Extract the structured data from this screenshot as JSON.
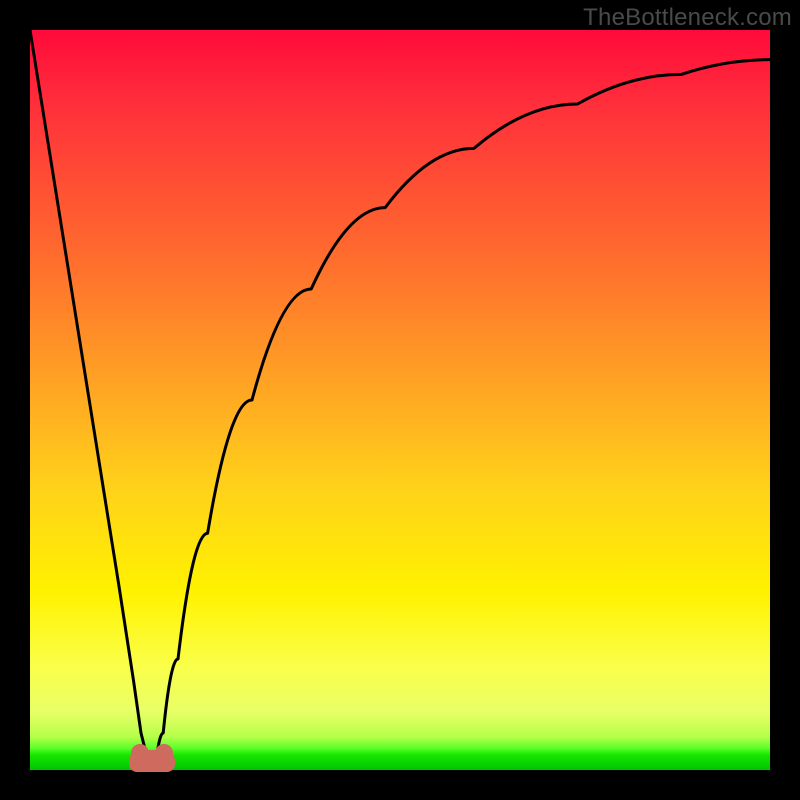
{
  "watermark": "TheBottleneck.com",
  "colors": {
    "frame": "#000000",
    "gradient_top": "#ff0a3a",
    "gradient_mid1": "#ff6a2e",
    "gradient_mid2": "#ffd21a",
    "gradient_mid3": "#fff200",
    "gradient_bottom": "#00c400",
    "curve_stroke": "#000000",
    "bump": "#cf6a5f"
  },
  "chart_data": {
    "type": "line",
    "title": "",
    "xlabel": "",
    "ylabel": "",
    "xlim": [
      0,
      100
    ],
    "ylim": [
      0,
      100
    ],
    "grid": false,
    "legend": false,
    "curve_note": "V-shaped bottleneck curve: steep linear descent from top-left to a minimum near x≈16, then a decelerating rise (roughly logarithmic) toward the top-right. Y is plotted with 0 at the bottom (green) and 100 at the top (red).",
    "x": [
      0,
      4,
      8,
      12,
      14,
      15,
      16,
      17,
      18,
      20,
      24,
      30,
      38,
      48,
      60,
      74,
      88,
      100
    ],
    "y": [
      100,
      75,
      50,
      25,
      12,
      5,
      1,
      1,
      5,
      15,
      32,
      50,
      65,
      76,
      84,
      90,
      94,
      96
    ],
    "minimum": {
      "x": 16.5,
      "y": 1
    }
  }
}
